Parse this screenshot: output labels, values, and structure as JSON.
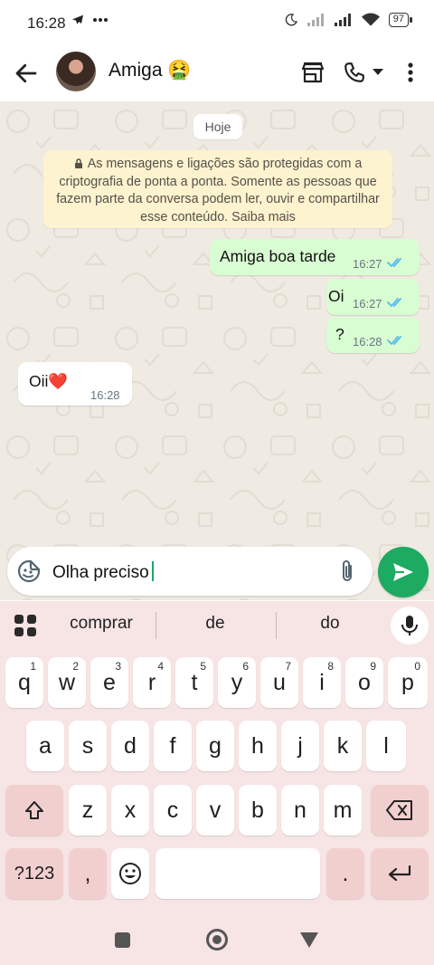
{
  "status_bar": {
    "time": "16:28",
    "battery": "97"
  },
  "header": {
    "contact_name": "Amiga 🤮"
  },
  "chat": {
    "date_chip": "Hoje",
    "encryption_notice": "As mensagens e ligações são protegidas com a criptografia de ponta a ponta. Somente as pessoas que fazem parte da conversa podem ler, ouvir e compartilhar esse conteúdo. Saiba mais",
    "messages": [
      {
        "direction": "out",
        "text": "Amiga boa tarde",
        "time": "16:27",
        "status": "read"
      },
      {
        "direction": "out",
        "text": "Oi",
        "time": "16:27",
        "status": "read"
      },
      {
        "direction": "out",
        "text": "?",
        "time": "16:28",
        "status": "read"
      },
      {
        "direction": "in",
        "text": "Oii❤️",
        "time": "16:28"
      }
    ]
  },
  "composer": {
    "text": "Olha preciso",
    "emoji_icon": "sticker-icon",
    "attach_icon": "paperclip-icon",
    "send_icon": "send-icon"
  },
  "keyboard": {
    "suggestions": [
      "comprar",
      "de",
      "do"
    ],
    "row1": [
      {
        "key": "q",
        "hint": "1"
      },
      {
        "key": "w",
        "hint": "2"
      },
      {
        "key": "e",
        "hint": "3"
      },
      {
        "key": "r",
        "hint": "4"
      },
      {
        "key": "t",
        "hint": "5"
      },
      {
        "key": "y",
        "hint": "6"
      },
      {
        "key": "u",
        "hint": "7"
      },
      {
        "key": "i",
        "hint": "8"
      },
      {
        "key": "o",
        "hint": "9"
      },
      {
        "key": "p",
        "hint": "0"
      }
    ],
    "row2": [
      "a",
      "s",
      "d",
      "f",
      "g",
      "h",
      "j",
      "k",
      "l"
    ],
    "row3": [
      "z",
      "x",
      "c",
      "v",
      "b",
      "n",
      "m"
    ],
    "symbols_label": "?123",
    "comma": ",",
    "period": "."
  },
  "colors": {
    "accent": "#1daa61",
    "outgoing_bubble": "#d9fdd3",
    "chat_background": "#efeae2",
    "read_ticks": "#53bdeb",
    "keyboard_background": "#f7e4e4"
  }
}
